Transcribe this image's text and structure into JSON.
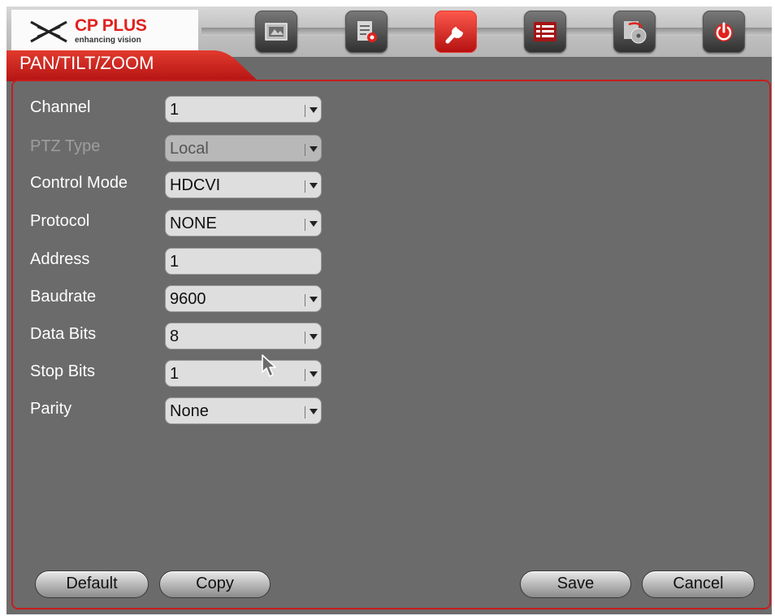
{
  "brand": {
    "name": "CP PLUS",
    "tagline": "enhancing vision",
    "color": "#e0221e"
  },
  "toolbar": {
    "buttons": [
      {
        "icon": "camera-icon",
        "active": false
      },
      {
        "icon": "record-settings-icon",
        "active": false
      },
      {
        "icon": "wrench-icon",
        "active": true
      },
      {
        "icon": "list-menu-icon",
        "active": false
      },
      {
        "icon": "backup-disc-icon",
        "active": false
      },
      {
        "icon": "power-icon",
        "active": false
      }
    ]
  },
  "page": {
    "title": "PAN/TILT/ZOOM",
    "accent": "#c81d1d"
  },
  "form": {
    "channel": {
      "label": "Channel",
      "value": "1"
    },
    "ptz_type": {
      "label": "PTZ Type",
      "value": "Local",
      "disabled": true
    },
    "control_mode": {
      "label": "Control Mode",
      "value": "HDCVI"
    },
    "protocol": {
      "label": "Protocol",
      "value": "NONE"
    },
    "address": {
      "label": "Address",
      "value": "1"
    },
    "baudrate": {
      "label": "Baudrate",
      "value": "9600"
    },
    "data_bits": {
      "label": "Data Bits",
      "value": "8"
    },
    "stop_bits": {
      "label": "Stop Bits",
      "value": "1"
    },
    "parity": {
      "label": "Parity",
      "value": "None"
    }
  },
  "buttons": {
    "default": "Default",
    "copy": "Copy",
    "save": "Save",
    "cancel": "Cancel"
  }
}
